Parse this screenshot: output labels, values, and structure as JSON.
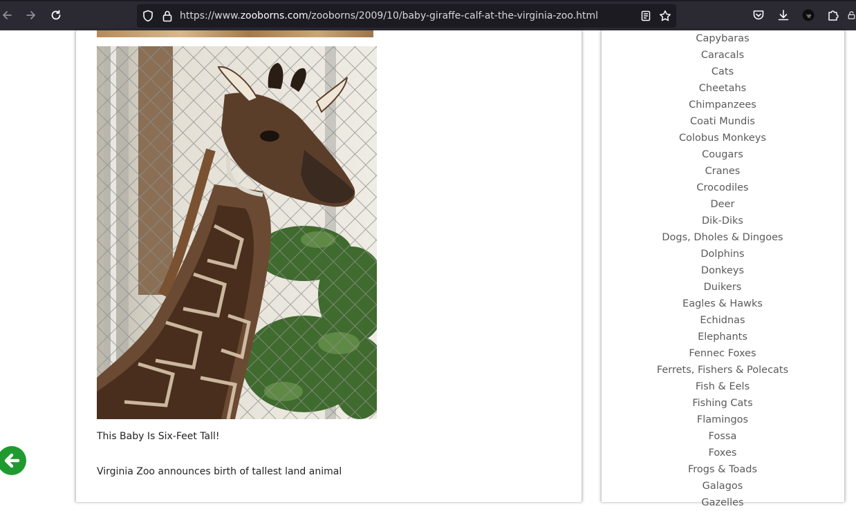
{
  "browser": {
    "url_prefix": "https://www.",
    "url_domain": "zooborns.com",
    "url_path": "/zooborns/2009/10/baby-giraffe-calf-at-the-virginia-zoo.html",
    "icons": {
      "back": "back-arrow-icon",
      "forward": "forward-arrow-icon",
      "reload": "reload-icon",
      "shield": "tracking-shield-icon",
      "lock": "lock-icon",
      "reader": "reader-view-icon",
      "bookmark": "bookmark-star-icon",
      "pocket": "pocket-icon",
      "downloads": "download-icon",
      "account": "account-avatar-icon",
      "extensions": "extensions-puzzle-icon"
    }
  },
  "article": {
    "image_alt": "Baby giraffe calf standing by a chain-link fence",
    "caption": "This Baby Is Six-Feet Tall!",
    "subhead": "Virginia Zoo announces birth of tallest land animal"
  },
  "sidebar": {
    "categories": [
      "Capybaras",
      "Caracals",
      "Cats",
      "Cheetahs",
      "Chimpanzees",
      "Coati Mundis",
      "Colobus Monkeys",
      "Cougars",
      "Cranes",
      "Crocodiles",
      "Deer",
      "Dik-Diks",
      "Dogs, Dholes & Dingoes",
      "Dolphins",
      "Donkeys",
      "Duikers",
      "Eagles & Hawks",
      "Echidnas",
      "Elephants",
      "Fennec Foxes",
      "Ferrets, Fishers & Polecats",
      "Fish & Eels",
      "Fishing Cats",
      "Flamingos",
      "Fossa",
      "Foxes",
      "Frogs & Toads",
      "Galagos",
      "Gazelles"
    ]
  },
  "colors": {
    "toolbar_bg": "#2b2a33",
    "urlbar_bg": "#1c1b22",
    "back_button_green": "#1f9a2f",
    "category_text": "#5a5a5a"
  }
}
